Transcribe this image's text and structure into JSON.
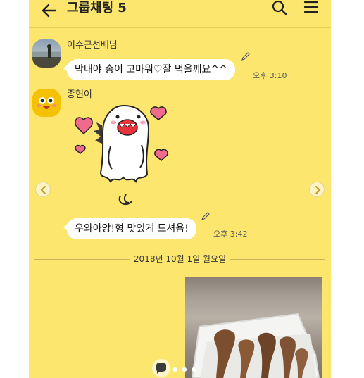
{
  "header": {
    "title": "그룹채팅",
    "member_count": "5"
  },
  "messages": [
    {
      "sender": "이수근선배님",
      "text": "막내야 송이 고마워♡잘 먹을께요^^",
      "time": "오후 3:10"
    },
    {
      "sender": "종현이",
      "text": "우와아앙!형 맛있게 드셔욤!",
      "time": "오후 3:42"
    }
  ],
  "date_divider": "2018년 10월 1일 월요일",
  "icons": {
    "back": "arrow-left-icon",
    "search": "search-icon",
    "menu": "hamburger-menu-icon",
    "edit": "pencil-icon",
    "prev": "chevron-left-icon",
    "next": "chevron-right-icon",
    "chat": "chat-bubble-icon"
  },
  "colors": {
    "chat_background": "#fce66e",
    "bubble": "#ffffff",
    "heart": "#f06a8e"
  }
}
